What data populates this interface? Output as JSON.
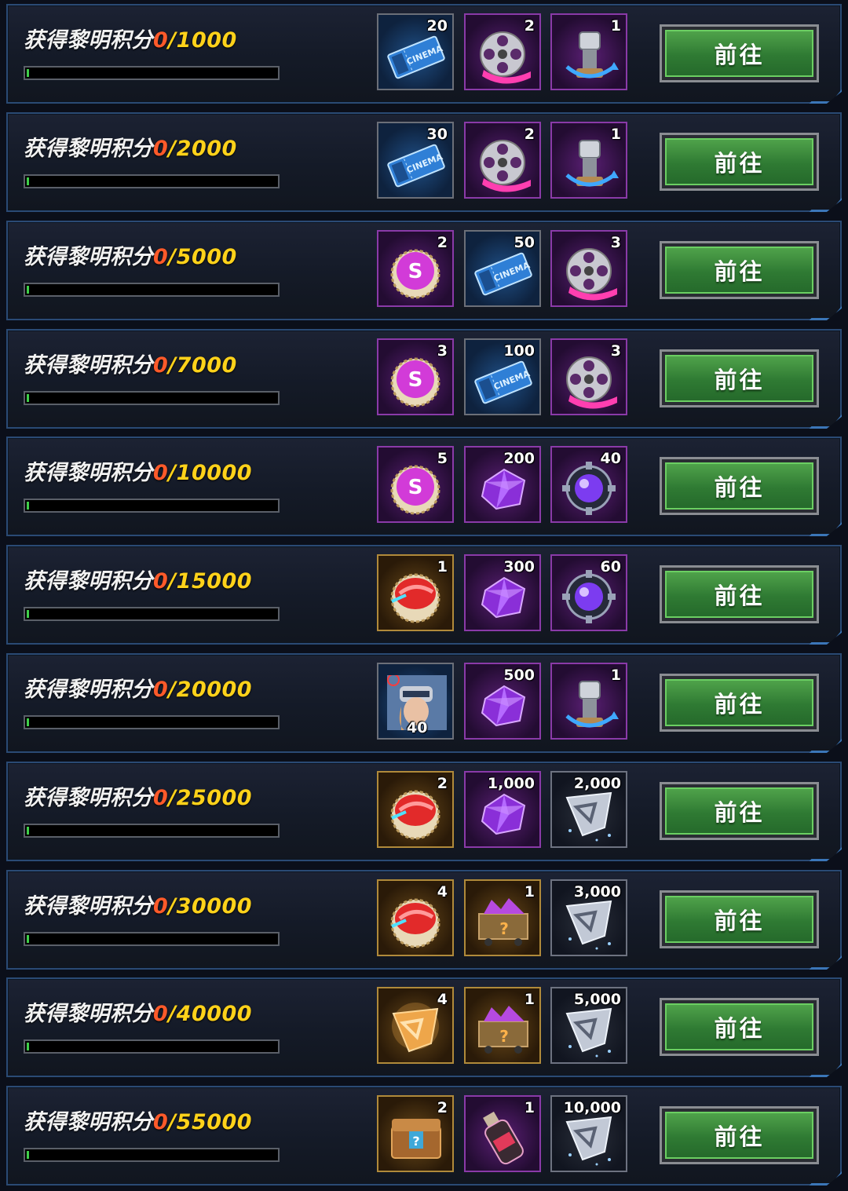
{
  "task_label": "获得黎明积分",
  "button_label": "前往",
  "current_points": "0",
  "rows": [
    {
      "goal": "1000",
      "rewards": [
        {
          "icon": "cinema-ticket-icon",
          "count": "20",
          "style": "blue"
        },
        {
          "icon": "film-reel-icon",
          "count": "2",
          "style": "purple"
        },
        {
          "icon": "mechanical-part-icon",
          "count": "1",
          "style": "purple"
        }
      ]
    },
    {
      "goal": "2000",
      "rewards": [
        {
          "icon": "cinema-ticket-icon",
          "count": "30",
          "style": "blue"
        },
        {
          "icon": "film-reel-icon",
          "count": "2",
          "style": "purple"
        },
        {
          "icon": "mechanical-part-icon",
          "count": "1",
          "style": "purple"
        }
      ]
    },
    {
      "goal": "5000",
      "rewards": [
        {
          "icon": "bottle-cap-icon",
          "count": "2",
          "style": "purple"
        },
        {
          "icon": "cinema-ticket-icon",
          "count": "50",
          "style": "blue"
        },
        {
          "icon": "film-reel-icon",
          "count": "3",
          "style": "purple"
        }
      ]
    },
    {
      "goal": "7000",
      "rewards": [
        {
          "icon": "bottle-cap-icon",
          "count": "3",
          "style": "purple"
        },
        {
          "icon": "cinema-ticket-icon",
          "count": "100",
          "style": "blue"
        },
        {
          "icon": "film-reel-icon",
          "count": "3",
          "style": "purple"
        }
      ]
    },
    {
      "goal": "10000",
      "rewards": [
        {
          "icon": "bottle-cap-icon",
          "count": "5",
          "style": "purple"
        },
        {
          "icon": "purple-crystal-icon",
          "count": "200",
          "style": "purple"
        },
        {
          "icon": "purple-orb-icon",
          "count": "40",
          "style": "purple"
        }
      ]
    },
    {
      "goal": "15000",
      "rewards": [
        {
          "icon": "red-bottle-cap-icon",
          "count": "1",
          "style": "gold"
        },
        {
          "icon": "purple-crystal-icon",
          "count": "300",
          "style": "purple"
        },
        {
          "icon": "purple-orb-icon",
          "count": "60",
          "style": "purple"
        }
      ]
    },
    {
      "goal": "20000",
      "rewards": [
        {
          "icon": "character-portrait-icon",
          "count": "40",
          "style": "blue",
          "countPos": "bottom"
        },
        {
          "icon": "purple-crystal-icon",
          "count": "500",
          "style": "purple"
        },
        {
          "icon": "mechanical-part-icon",
          "count": "1",
          "style": "purple"
        }
      ]
    },
    {
      "goal": "25000",
      "rewards": [
        {
          "icon": "red-bottle-cap-icon",
          "count": "2",
          "style": "gold"
        },
        {
          "icon": "purple-crystal-icon",
          "count": "1,000",
          "style": "purple"
        },
        {
          "icon": "silver-emblem-icon",
          "count": "2,000",
          "style": "dark"
        }
      ]
    },
    {
      "goal": "30000",
      "rewards": [
        {
          "icon": "red-bottle-cap-icon",
          "count": "4",
          "style": "gold"
        },
        {
          "icon": "mine-cart-icon",
          "count": "1",
          "style": "gold"
        },
        {
          "icon": "silver-emblem-icon",
          "count": "3,000",
          "style": "dark"
        }
      ]
    },
    {
      "goal": "40000",
      "rewards": [
        {
          "icon": "gold-emblem-icon",
          "count": "4",
          "style": "gold"
        },
        {
          "icon": "mine-cart-icon",
          "count": "1",
          "style": "gold"
        },
        {
          "icon": "silver-emblem-icon",
          "count": "5,000",
          "style": "dark"
        }
      ]
    },
    {
      "goal": "55000",
      "rewards": [
        {
          "icon": "mystery-chest-icon",
          "count": "2",
          "style": "gold"
        },
        {
          "icon": "potion-bottle-icon",
          "count": "1",
          "style": "purple"
        },
        {
          "icon": "silver-emblem-icon",
          "count": "10,000",
          "style": "dark"
        }
      ]
    }
  ],
  "progress_fraction": 0.0
}
